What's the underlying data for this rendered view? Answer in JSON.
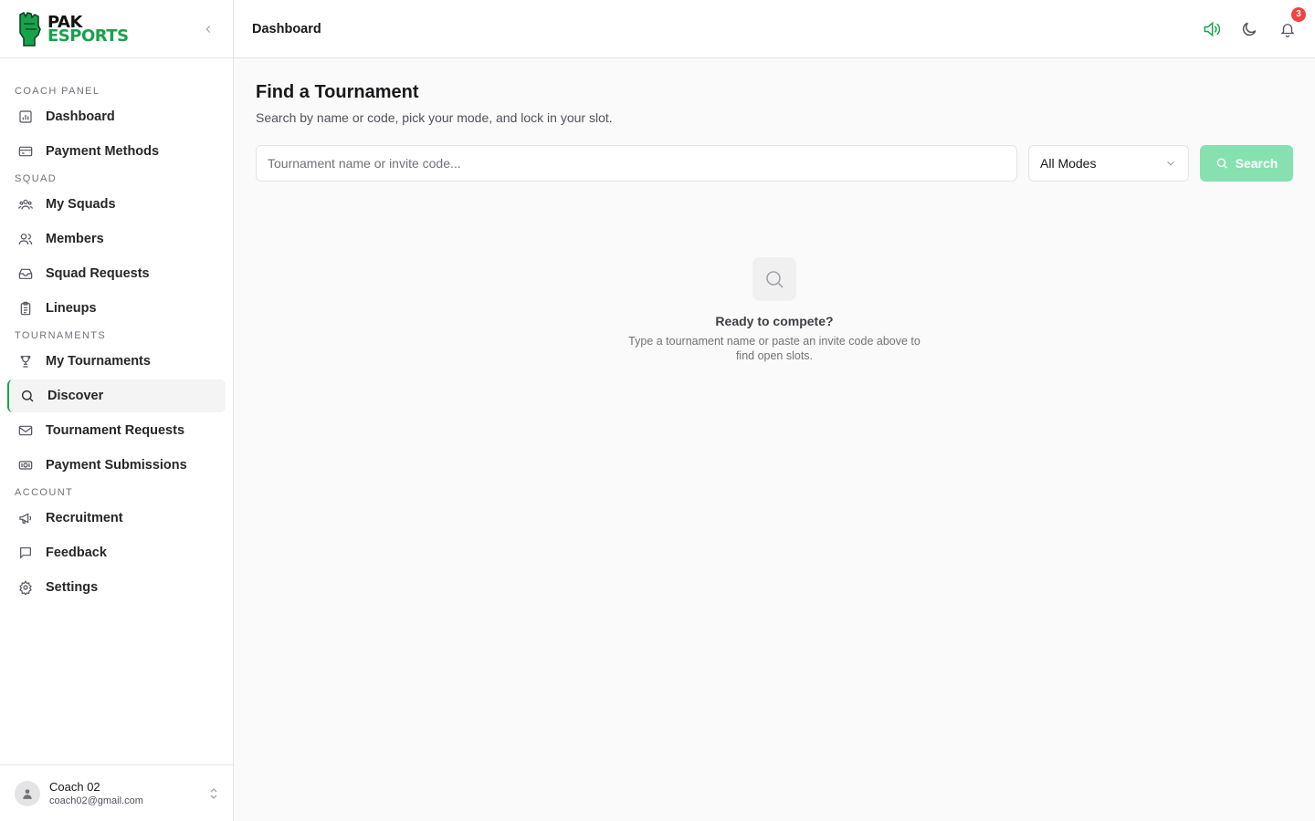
{
  "brand": {
    "line1": "PAK",
    "line2": "ESPORTS",
    "accent": "#16a34a"
  },
  "sidebar": {
    "sections": [
      {
        "label": "Coach Panel",
        "items": [
          {
            "label": "Dashboard",
            "icon": "bar-chart-icon"
          },
          {
            "label": "Payment Methods",
            "icon": "credit-card-icon"
          }
        ]
      },
      {
        "label": "Squad",
        "items": [
          {
            "label": "My Squads",
            "icon": "users-group-icon"
          },
          {
            "label": "Members",
            "icon": "users-icon"
          },
          {
            "label": "Squad Requests",
            "icon": "inbox-icon"
          },
          {
            "label": "Lineups",
            "icon": "clipboard-icon"
          }
        ]
      },
      {
        "label": "Tournaments",
        "items": [
          {
            "label": "My Tournaments",
            "icon": "trophy-icon"
          },
          {
            "label": "Discover",
            "icon": "search-icon",
            "active": true
          },
          {
            "label": "Tournament Requests",
            "icon": "mail-icon"
          },
          {
            "label": "Payment Submissions",
            "icon": "cash-icon"
          }
        ]
      },
      {
        "label": "Account",
        "items": [
          {
            "label": "Recruitment",
            "icon": "megaphone-icon"
          },
          {
            "label": "Feedback",
            "icon": "message-icon"
          },
          {
            "label": "Settings",
            "icon": "gear-icon"
          }
        ]
      }
    ]
  },
  "user": {
    "name": "Coach 02",
    "email": "coach02@gmail.com"
  },
  "header": {
    "title": "Dashboard",
    "notification_count": "3"
  },
  "main": {
    "title": "Find a Tournament",
    "subtitle": "Search by name or code, pick your mode, and lock in your slot.",
    "search_placeholder": "Tournament name or invite code...",
    "mode_selected": "All Modes",
    "search_label": "Search"
  },
  "empty_state": {
    "title": "Ready to compete?",
    "text": "Type a tournament name or paste an invite code above to find open slots."
  }
}
